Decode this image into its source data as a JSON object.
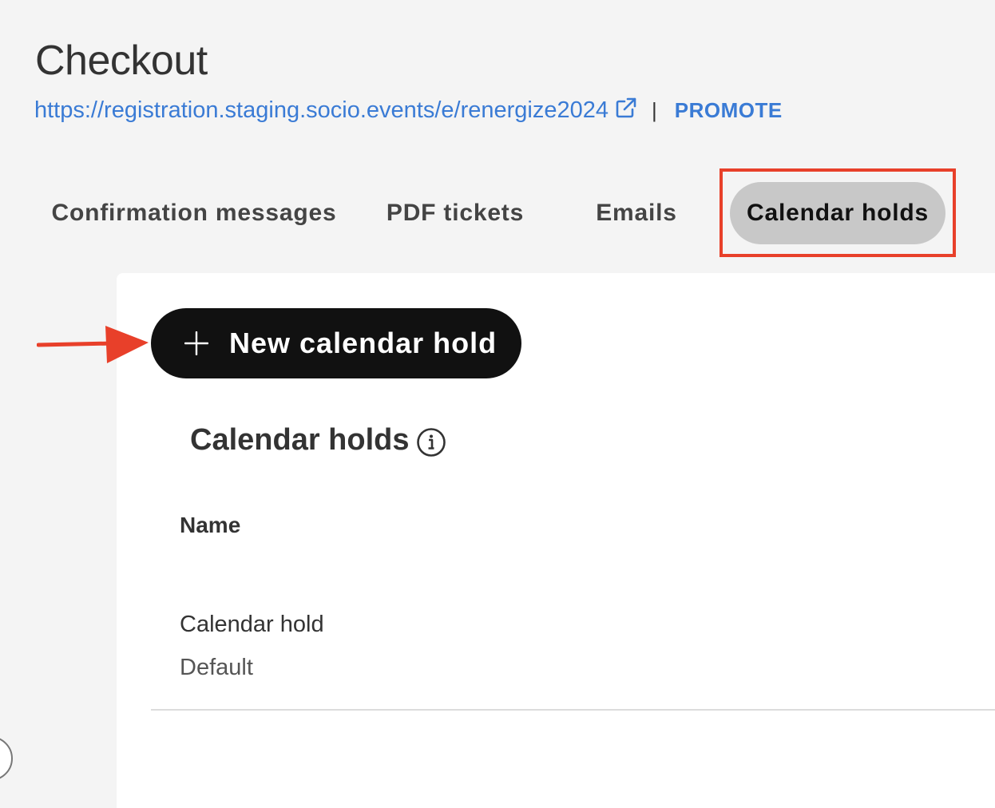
{
  "header": {
    "title": "Checkout",
    "event_url": "https://registration.staging.socio.events/e/renergize2024",
    "separator": "|",
    "promote_label": "PROMOTE"
  },
  "tabs": [
    {
      "label": "Confirmation messages",
      "active": false
    },
    {
      "label": "PDF tickets",
      "active": false
    },
    {
      "label": "Emails",
      "active": false
    },
    {
      "label": "Calendar holds",
      "active": true
    }
  ],
  "actions": {
    "new_calendar_hold_label": "New calendar hold"
  },
  "section": {
    "title": "Calendar holds",
    "column_header": "Name",
    "rows": [
      {
        "name": "Calendar hold",
        "subtitle": "Default"
      }
    ]
  },
  "colors": {
    "link": "#3a7bd5",
    "annotation_red": "#e8402a",
    "active_tab_bg": "#c8c8c8",
    "primary_button_bg": "#111111"
  },
  "icons": [
    "external-link-icon",
    "plus-icon",
    "info-icon",
    "arrow-annotation"
  ]
}
